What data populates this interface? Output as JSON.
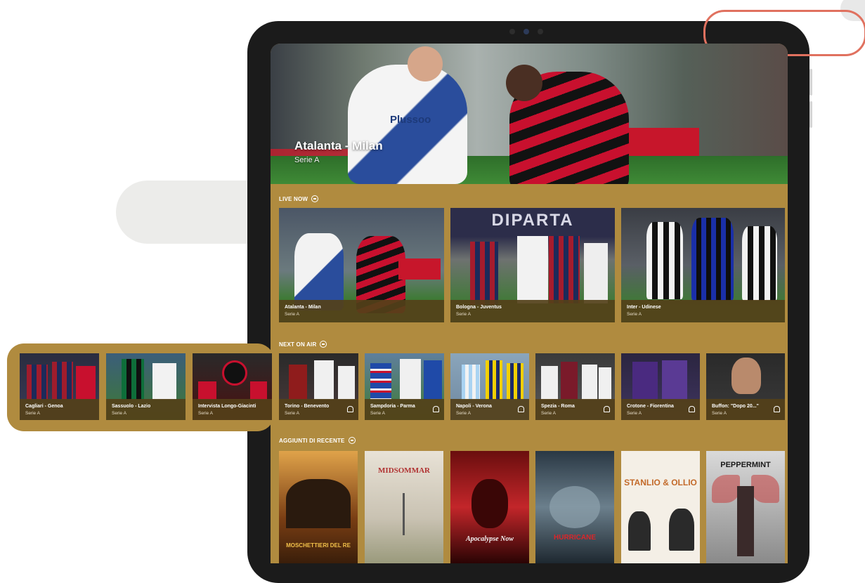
{
  "hero": {
    "title": "Atalanta - Milan",
    "subtitle": "Serie A",
    "jersey_text": "Plussoo"
  },
  "sections": {
    "live_now": "LIVE NOW",
    "next_on_air": "NEXT ON AIR",
    "recent": "AGGIUNTI DI RECENTE"
  },
  "live_cards": [
    {
      "title": "Atalanta - Milan",
      "sub": "Serie A"
    },
    {
      "title": "Bologna - Juventus",
      "sub": "Serie A"
    },
    {
      "title": "Inter - Udinese",
      "sub": "Serie A"
    }
  ],
  "next_cards": [
    {
      "title": "Cagliari - Genoa",
      "sub": "Serie A"
    },
    {
      "title": "Sassuolo - Lazio",
      "sub": "Serie A"
    },
    {
      "title": "Intervista Longo-Giacinti",
      "sub": "Serie A"
    },
    {
      "title": "Torino - Benevento",
      "sub": "Serie A"
    },
    {
      "title": "Sampdoria - Parma",
      "sub": "Serie A"
    },
    {
      "title": "Napoli - Verona",
      "sub": "Serie A"
    },
    {
      "title": "Spezia - Roma",
      "sub": "Serie A"
    },
    {
      "title": "Crotone - Fiorentina",
      "sub": "Serie A"
    },
    {
      "title": "Buffon: \"Dopo 20...\"",
      "sub": "Serie A"
    }
  ],
  "posters": [
    {
      "title": "MOSCHETTIERI DEL RE"
    },
    {
      "title": "MIDSOMMAR"
    },
    {
      "title": "Apocalypse Now"
    },
    {
      "title": "HURRICANE"
    },
    {
      "title": "STANLIO & OLLIO"
    },
    {
      "title": "PEPPERMINT"
    }
  ],
  "colors": {
    "accent": "#b08b3f",
    "caption": "#544019",
    "ring": "#e0715f"
  }
}
